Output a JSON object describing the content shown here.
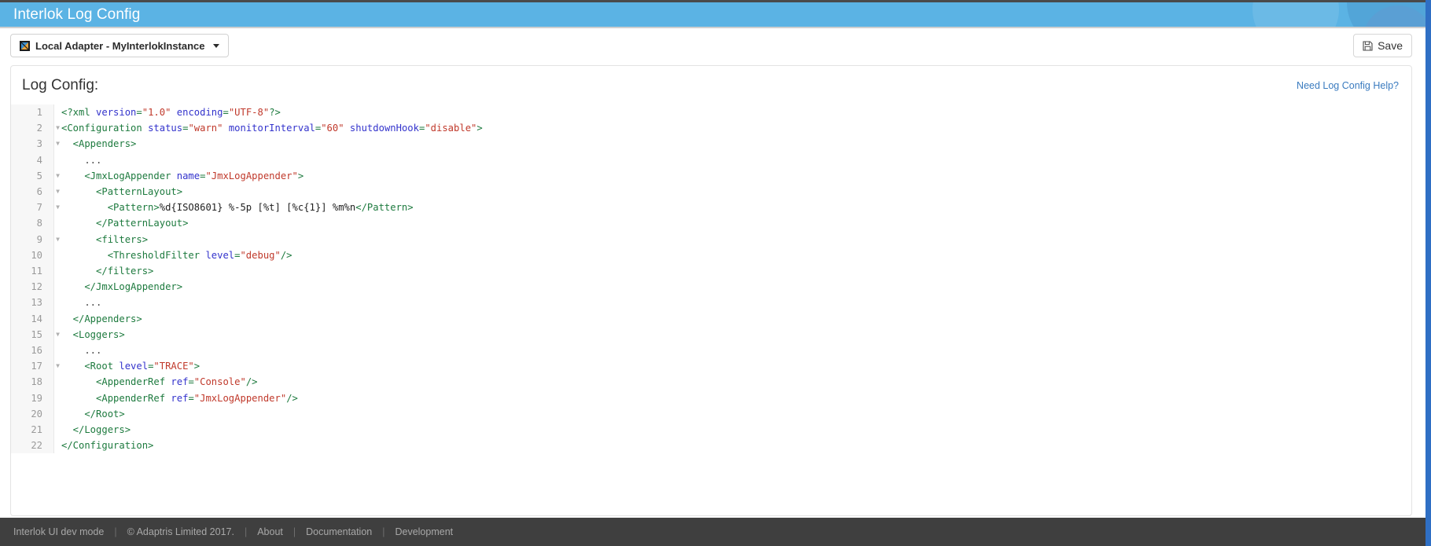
{
  "header": {
    "title": "Interlok Log Config",
    "accent_color": "#5bb3e4"
  },
  "toolbar": {
    "adapter_label": "Local Adapter - MyInterlokInstance",
    "adapter_icon": "adapter-icon",
    "caret_icon": "chevron-down-icon",
    "save_label": "Save",
    "save_icon": "floppy-disk-icon"
  },
  "panel": {
    "title": "Log Config:",
    "help_link": "Need Log Config Help?",
    "help_link_color": "#3a7bbf"
  },
  "editor": {
    "language": "xml",
    "line_count": 22,
    "lines": [
      {
        "n": "1",
        "fold": false,
        "tokens": [
          {
            "t": "punct",
            "v": "<?xml "
          },
          {
            "t": "attr",
            "v": "version"
          },
          {
            "t": "punct",
            "v": "="
          },
          {
            "t": "str",
            "v": "\"1.0\""
          },
          {
            "t": "punct",
            "v": " "
          },
          {
            "t": "attr",
            "v": "encoding"
          },
          {
            "t": "punct",
            "v": "="
          },
          {
            "t": "str",
            "v": "\"UTF-8\""
          },
          {
            "t": "punct",
            "v": "?>"
          }
        ]
      },
      {
        "n": "2",
        "fold": true,
        "tokens": [
          {
            "t": "tag",
            "v": "<Configuration "
          },
          {
            "t": "attr",
            "v": "status"
          },
          {
            "t": "punct",
            "v": "="
          },
          {
            "t": "str",
            "v": "\"warn\""
          },
          {
            "t": "punct",
            "v": " "
          },
          {
            "t": "attr",
            "v": "monitorInterval"
          },
          {
            "t": "punct",
            "v": "="
          },
          {
            "t": "str",
            "v": "\"60\""
          },
          {
            "t": "punct",
            "v": " "
          },
          {
            "t": "attr",
            "v": "shutdownHook"
          },
          {
            "t": "punct",
            "v": "="
          },
          {
            "t": "str",
            "v": "\"disable\""
          },
          {
            "t": "tag",
            "v": ">"
          }
        ]
      },
      {
        "n": "3",
        "fold": true,
        "tokens": [
          {
            "t": "tag",
            "v": "  <Appenders>"
          }
        ]
      },
      {
        "n": "4",
        "fold": false,
        "tokens": [
          {
            "t": "dots",
            "v": "    ..."
          }
        ]
      },
      {
        "n": "5",
        "fold": true,
        "tokens": [
          {
            "t": "tag",
            "v": "    <JmxLogAppender "
          },
          {
            "t": "attr",
            "v": "name"
          },
          {
            "t": "punct",
            "v": "="
          },
          {
            "t": "str",
            "v": "\"JmxLogAppender\""
          },
          {
            "t": "tag",
            "v": ">"
          }
        ]
      },
      {
        "n": "6",
        "fold": true,
        "tokens": [
          {
            "t": "tag",
            "v": "      <PatternLayout>"
          }
        ]
      },
      {
        "n": "7",
        "fold": true,
        "tokens": [
          {
            "t": "tag",
            "v": "        <Pattern>"
          },
          {
            "t": "text",
            "v": "%d{ISO8601} %-5p [%t] [%c{1}] %m%n"
          },
          {
            "t": "tag",
            "v": "</Pattern>"
          }
        ]
      },
      {
        "n": "8",
        "fold": false,
        "tokens": [
          {
            "t": "tag",
            "v": "      </PatternLayout>"
          }
        ]
      },
      {
        "n": "9",
        "fold": true,
        "tokens": [
          {
            "t": "tag",
            "v": "      <filters>"
          }
        ]
      },
      {
        "n": "10",
        "fold": false,
        "tokens": [
          {
            "t": "tag",
            "v": "        <ThresholdFilter "
          },
          {
            "t": "attr",
            "v": "level"
          },
          {
            "t": "punct",
            "v": "="
          },
          {
            "t": "str",
            "v": "\"debug\""
          },
          {
            "t": "tag",
            "v": "/>"
          }
        ]
      },
      {
        "n": "11",
        "fold": false,
        "tokens": [
          {
            "t": "tag",
            "v": "      </filters>"
          }
        ]
      },
      {
        "n": "12",
        "fold": false,
        "tokens": [
          {
            "t": "tag",
            "v": "    </JmxLogAppender>"
          }
        ]
      },
      {
        "n": "13",
        "fold": false,
        "tokens": [
          {
            "t": "dots",
            "v": "    ..."
          }
        ]
      },
      {
        "n": "14",
        "fold": false,
        "tokens": [
          {
            "t": "tag",
            "v": "  </Appenders>"
          }
        ]
      },
      {
        "n": "15",
        "fold": true,
        "tokens": [
          {
            "t": "tag",
            "v": "  <Loggers>"
          }
        ]
      },
      {
        "n": "16",
        "fold": false,
        "tokens": [
          {
            "t": "dots",
            "v": "    ..."
          }
        ]
      },
      {
        "n": "17",
        "fold": true,
        "tokens": [
          {
            "t": "tag",
            "v": "    <Root "
          },
          {
            "t": "attr",
            "v": "level"
          },
          {
            "t": "punct",
            "v": "="
          },
          {
            "t": "str",
            "v": "\"TRACE\""
          },
          {
            "t": "tag",
            "v": ">"
          }
        ]
      },
      {
        "n": "18",
        "fold": false,
        "tokens": [
          {
            "t": "tag",
            "v": "      <AppenderRef "
          },
          {
            "t": "attr",
            "v": "ref"
          },
          {
            "t": "punct",
            "v": "="
          },
          {
            "t": "str",
            "v": "\"Console\""
          },
          {
            "t": "tag",
            "v": "/>"
          }
        ]
      },
      {
        "n": "19",
        "fold": false,
        "tokens": [
          {
            "t": "tag",
            "v": "      <AppenderRef "
          },
          {
            "t": "attr",
            "v": "ref"
          },
          {
            "t": "punct",
            "v": "="
          },
          {
            "t": "str",
            "v": "\"JmxLogAppender\""
          },
          {
            "t": "tag",
            "v": "/>"
          }
        ]
      },
      {
        "n": "20",
        "fold": false,
        "tokens": [
          {
            "t": "tag",
            "v": "    </Root>"
          }
        ]
      },
      {
        "n": "21",
        "fold": false,
        "tokens": [
          {
            "t": "tag",
            "v": "  </Loggers>"
          }
        ]
      },
      {
        "n": "22",
        "fold": false,
        "tokens": [
          {
            "t": "tag",
            "v": "</Configuration>"
          }
        ]
      }
    ]
  },
  "footer": {
    "brand": "Interlok UI  dev mode",
    "copyright": "© Adaptris Limited 2017.",
    "separator": "|",
    "links": [
      {
        "label": "About"
      },
      {
        "label": "Documentation"
      },
      {
        "label": "Development"
      }
    ]
  }
}
